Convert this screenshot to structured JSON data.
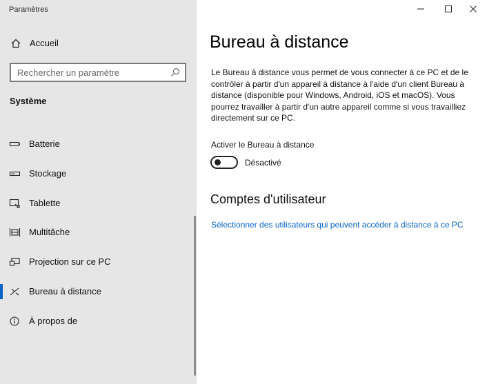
{
  "app": {
    "title": "Paramètres"
  },
  "window_controls": {
    "minimize_icon": "minimize-icon",
    "maximize_icon": "maximize-icon",
    "close_icon": "close-icon"
  },
  "sidebar": {
    "home_label": "Accueil",
    "home_icon": "home-icon",
    "search": {
      "placeholder": "Rechercher un paramètre",
      "value": "",
      "icon": "search-icon"
    },
    "section": "Système",
    "items": [
      {
        "label": "Batterie",
        "icon": "battery-icon",
        "selected": false
      },
      {
        "label": "Stockage",
        "icon": "storage-icon",
        "selected": false
      },
      {
        "label": "Tablette",
        "icon": "tablet-icon",
        "selected": false
      },
      {
        "label": "Multitâche",
        "icon": "multitask-icon",
        "selected": false
      },
      {
        "label": "Projection sur ce PC",
        "icon": "projection-icon",
        "selected": false
      },
      {
        "label": "Bureau à distance",
        "icon": "remote-desktop-icon",
        "selected": true
      },
      {
        "label": "À propos de",
        "icon": "info-icon",
        "selected": false
      }
    ]
  },
  "main": {
    "title": "Bureau à distance",
    "description": "Le Bureau à distance vous permet de vous connecter à ce PC et de le contrôler à partir d'un appareil à distance à l'aide d'un client Bureau à distance (disponible pour Windows, Android, iOS et macOS). Vous pourrez travailler à partir d'un autre appareil comme si vous travailliez directement sur ce PC.",
    "toggle": {
      "label": "Activer le Bureau à distance",
      "state_text": "Désactivé",
      "on": false
    },
    "accounts": {
      "title": "Comptes d'utilisateur",
      "link": "Sélectionner des utilisateurs qui peuvent accéder à distance à ce PC"
    }
  },
  "colors": {
    "sidebar_bg": "#e6e6e6",
    "accent": "#0a64c8",
    "link": "#0a64c8"
  }
}
